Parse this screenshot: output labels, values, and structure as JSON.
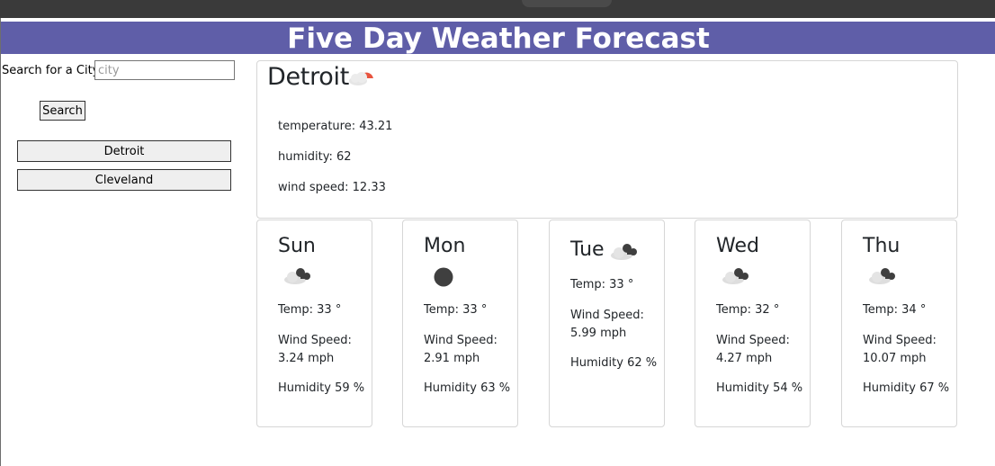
{
  "header": {
    "title": "Five Day Weather Forecast"
  },
  "sidebar": {
    "search_label": "Search for a City:",
    "search_placeholder": "city",
    "search_value": "",
    "search_button": "Search",
    "cities": [
      "Detroit",
      "Cleveland"
    ]
  },
  "current": {
    "city": "Detroit",
    "icon": "partly-cloudy-day-icon",
    "temperature": "temperature: 43.21",
    "humidity": "humidity: 62",
    "wind_speed": "wind speed: 12.33"
  },
  "forecast": [
    {
      "day": "Sun",
      "icon": "broken-clouds-icon",
      "temp": "Temp: 33 °",
      "wind": "Wind Speed: 3.24 mph",
      "humidity": "Humidity 59 %"
    },
    {
      "day": "Mon",
      "icon": "overcast-icon",
      "temp": "Temp: 33 °",
      "wind": "Wind Speed: 2.91 mph",
      "humidity": "Humidity 63 %"
    },
    {
      "day": "Tue",
      "icon": "broken-clouds-icon",
      "temp": "Temp: 33 °",
      "wind": "Wind Speed: 5.99 mph",
      "humidity": "Humidity 62 %"
    },
    {
      "day": "Wed",
      "icon": "broken-clouds-icon",
      "temp": "Temp: 32 °",
      "wind": "Wind Speed: 4.27 mph",
      "humidity": "Humidity 54 %"
    },
    {
      "day": "Thu",
      "icon": "broken-clouds-icon",
      "temp": "Temp: 34 °",
      "wind": "Wind Speed: 10.07 mph",
      "humidity": "Humidity 67 %"
    }
  ],
  "colors": {
    "header_bg": "#5f5ea8",
    "browser_bar": "#3a3a3a",
    "sun": "#e8543f"
  }
}
